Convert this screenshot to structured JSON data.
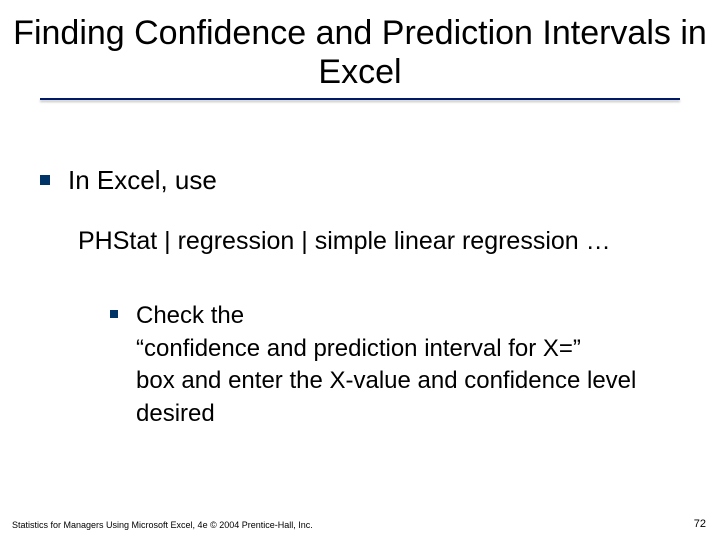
{
  "title": "Finding Confidence and Prediction Intervals in Excel",
  "bullets": {
    "level1": "In Excel, use",
    "level2": "PHStat | regression | simple linear regression …",
    "level3": "Check the\n“confidence and prediction interval for X=”\n box and enter the X-value and confidence level desired"
  },
  "footer": "Statistics for Managers Using Microsoft Excel, 4e © 2004 Prentice-Hall, Inc.",
  "page_number": "72"
}
